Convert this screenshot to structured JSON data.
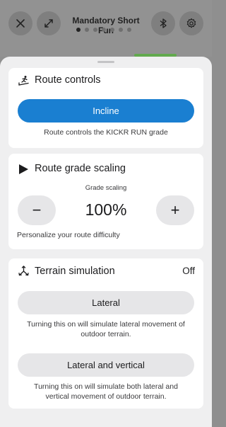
{
  "header": {
    "title": "Mandatory Short Fun",
    "page_count": 7,
    "active_page": 1
  },
  "route_controls": {
    "title": "Route controls",
    "button_label": "Incline",
    "caption": "Route controls the KICKR RUN grade"
  },
  "grade_scaling": {
    "title": "Route grade scaling",
    "label": "Grade scaling",
    "value": "100%",
    "minus_label": "−",
    "plus_label": "+",
    "caption": "Personalize your route difficulty"
  },
  "terrain": {
    "title": "Terrain simulation",
    "status": "Off",
    "lateral_label": "Lateral",
    "lateral_caption_1": "Turning this on will simulate lateral movement of",
    "lateral_caption_2": "outdoor terrain.",
    "lv_label": "Lateral and vertical",
    "lv_caption_1": "Turning this on will simulate both lateral and",
    "lv_caption_2": "vertical movement of outdoor terrain."
  },
  "colors": {
    "accent": "#1a7fd1",
    "sheet_bg": "#efeff0",
    "card_bg": "#ffffff"
  },
  "icons": [
    "close-icon",
    "expand-icon",
    "bluetooth-icon",
    "gear-icon",
    "treadmill-icon",
    "play-icon",
    "terrain-icon"
  ]
}
